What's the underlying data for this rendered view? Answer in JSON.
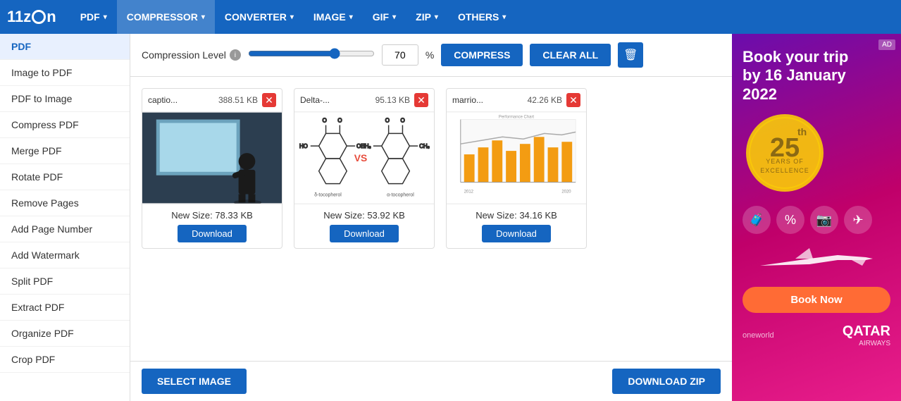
{
  "logo": {
    "text_1": "11z",
    "text_2": "n"
  },
  "nav": {
    "items": [
      {
        "label": "PDF",
        "id": "pdf"
      },
      {
        "label": "COMPRESSOR",
        "id": "compressor"
      },
      {
        "label": "CONVERTER",
        "id": "converter"
      },
      {
        "label": "IMAGE",
        "id": "image"
      },
      {
        "label": "GIF",
        "id": "gif"
      },
      {
        "label": "ZIP",
        "id": "zip"
      },
      {
        "label": "OTHERS",
        "id": "others"
      }
    ]
  },
  "sidebar": {
    "items": [
      {
        "label": "PDF",
        "id": "pdf",
        "active": true
      },
      {
        "label": "Image to PDF",
        "id": "image-to-pdf"
      },
      {
        "label": "PDF to Image",
        "id": "pdf-to-image"
      },
      {
        "label": "Compress PDF",
        "id": "compress-pdf"
      },
      {
        "label": "Merge PDF",
        "id": "merge-pdf"
      },
      {
        "label": "Rotate PDF",
        "id": "rotate-pdf"
      },
      {
        "label": "Remove Pages",
        "id": "remove-pages"
      },
      {
        "label": "Add Page Number",
        "id": "add-page-number"
      },
      {
        "label": "Add Watermark",
        "id": "add-watermark"
      },
      {
        "label": "Split PDF",
        "id": "split-pdf"
      },
      {
        "label": "Extract PDF",
        "id": "extract-pdf"
      },
      {
        "label": "Organize PDF",
        "id": "organize-pdf"
      },
      {
        "label": "Crop PDF",
        "id": "crop-pdf"
      }
    ]
  },
  "controls": {
    "compression_label": "Compression Level",
    "slider_value": 70,
    "percent_value": "70",
    "percent_sign": "%",
    "compress_btn": "COMPRESS",
    "clear_btn": "CLEAR ALL"
  },
  "files": [
    {
      "name": "captio...",
      "size": "388.51 KB",
      "new_size": "New Size: 78.33 KB",
      "download_label": "Download",
      "preview_type": "person"
    },
    {
      "name": "Delta-...",
      "size": "95.13 KB",
      "new_size": "New Size: 53.92 KB",
      "download_label": "Download",
      "preview_type": "chemistry"
    },
    {
      "name": "marrio...",
      "size": "42.26 KB",
      "new_size": "New Size: 34.16 KB",
      "download_label": "Download",
      "preview_type": "chart"
    }
  ],
  "bottom": {
    "select_btn": "SELECT IMAGE",
    "download_zip_btn": "DOWNLOAD ZIP"
  },
  "ad": {
    "badge": "AD",
    "title_line1": "Book your trip",
    "title_line2": "by 16 January",
    "title_line3": "2022",
    "year_number": "25",
    "year_suffix": "th",
    "years_text": "YEARS OF\nEXCELLENCE",
    "book_btn": "Book Now",
    "logo_sub": "oneworld",
    "airline": "QATAR",
    "airline_sub": "AIRWAYS"
  }
}
